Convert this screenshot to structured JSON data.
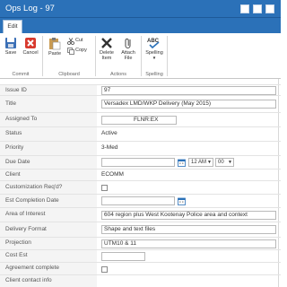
{
  "window": {
    "title": "Ops Log - 97"
  },
  "ribbon": {
    "tab": "Edit",
    "groups": {
      "commit": {
        "label": "Commit",
        "save": "Save",
        "cancel": "Cancel"
      },
      "clipboard": {
        "label": "Clipboard",
        "paste": "Paste",
        "cut": "Cut",
        "copy": "Copy"
      },
      "actions": {
        "label": "Actions",
        "delete_item": [
          "Delete",
          "Item"
        ],
        "attach_file": [
          "Attach",
          "File"
        ]
      },
      "spelling": {
        "label": "Spelling",
        "spelling": "Spelling",
        "abc": "ABC"
      }
    }
  },
  "form": {
    "issue_id": {
      "label": "Issue ID",
      "value": "97"
    },
    "title": {
      "label": "Title",
      "value": "Versadex LMD/WKP Delivery (May 2015)"
    },
    "assigned_to": {
      "label": "Assigned To",
      "value": "FLNR:EX"
    },
    "status": {
      "label": "Status",
      "value": "Active"
    },
    "priority": {
      "label": "Priority",
      "value": "3-Med"
    },
    "due_date": {
      "label": "Due Date",
      "value": "",
      "hour": "12 AM",
      "minute": "00"
    },
    "client": {
      "label": "Client",
      "value": "ECOMM"
    },
    "customization_req": {
      "label": "Customization Req'd?",
      "checked": false
    },
    "est_completion_date": {
      "label": "Est Completion Date",
      "value": ""
    },
    "area_of_interest": {
      "label": "Area of Interest",
      "value": "604 region plus West Kootenay Police area and context"
    },
    "delivery_format": {
      "label": "Delivery Format",
      "value": "Shape and text files"
    },
    "projection": {
      "label": "Projection",
      "value": "UTM10 & 11"
    },
    "cost_est": {
      "label": "Cost Est",
      "value": ""
    },
    "agreement_complete": {
      "label": "Agreement complete",
      "checked": false
    },
    "client_contact_info": {
      "label": "Client contact info",
      "value": ""
    }
  },
  "colors": {
    "title_bar": "#2b71b8",
    "label_bg": "#f4f4f4",
    "border": "#e3e3e3"
  }
}
